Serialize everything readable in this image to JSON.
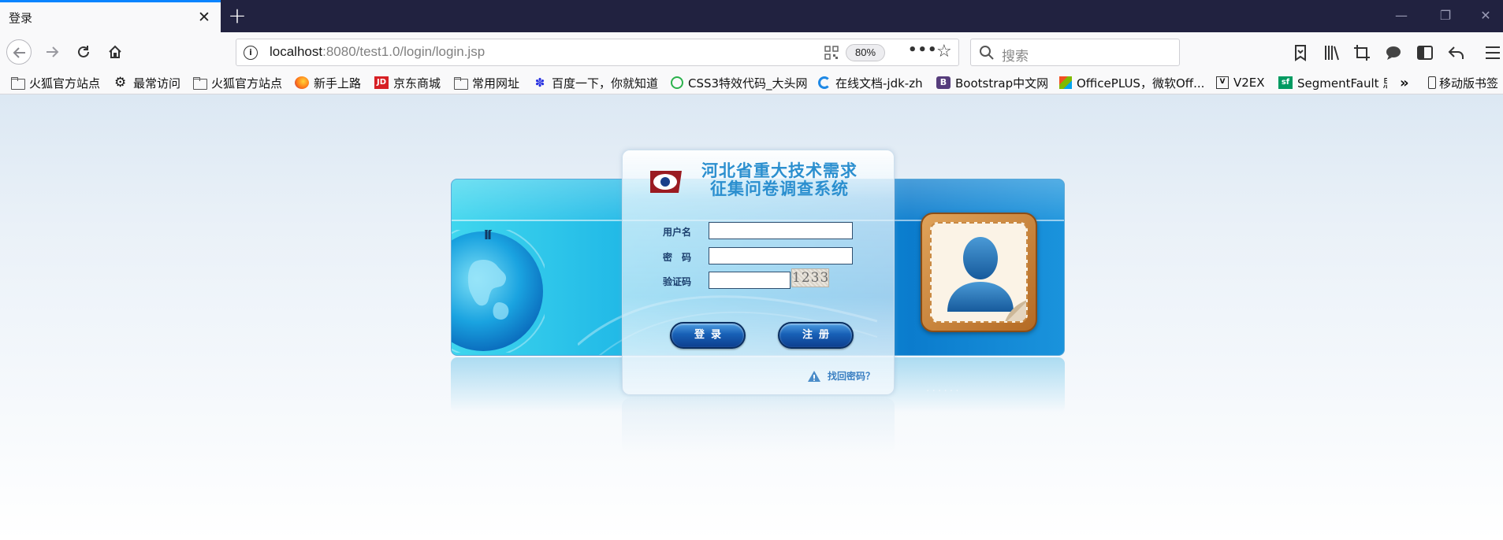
{
  "browser": {
    "tab_title": "登录",
    "url_host": "localhost",
    "url_rest": ":8080/test1.0/login/login.jsp",
    "zoom": "80%",
    "search_placeholder": "搜索"
  },
  "bookmarks": [
    {
      "label": "火狐官方站点",
      "icon": "folder-icon"
    },
    {
      "label": "最常访问",
      "icon": "gear-icon"
    },
    {
      "label": "火狐官方站点",
      "icon": "folder-icon"
    },
    {
      "label": "新手上路",
      "icon": "firefox-icon"
    },
    {
      "label": "京东商城",
      "icon": "jd-icon"
    },
    {
      "label": "常用网址",
      "icon": "folder-icon"
    },
    {
      "label": "百度一下，你就知道",
      "icon": "baidu-icon"
    },
    {
      "label": "CSS3特效代码_大头网",
      "icon": "site-icon"
    },
    {
      "label": "在线文档-jdk-zh",
      "icon": "site-icon"
    },
    {
      "label": "Bootstrap中文网",
      "icon": "bootstrap-icon"
    },
    {
      "label": "OfficePLUS，微软Off...",
      "icon": "office-icon"
    },
    {
      "label": "V2EX",
      "icon": "v2ex-icon"
    },
    {
      "label": "SegmentFault 思",
      "icon": "segmentfault-icon"
    },
    {
      "label": "移动版书签",
      "icon": "mobile-icon"
    }
  ],
  "login": {
    "title_line1": "河北省重大技术需求",
    "title_line2": "征集问卷调查系统",
    "username_label": "用户名",
    "password_label": "密　码",
    "captcha_label": "验证码",
    "captcha_text": "1233",
    "login_button": "登录",
    "register_button": "注册",
    "forgot_link": "找回密码？",
    "dots": "......"
  },
  "colors": {
    "accent": "#0a84ff",
    "titlebar": "#212240",
    "button": "#1860b6",
    "title_text": "#2b8fcf"
  }
}
